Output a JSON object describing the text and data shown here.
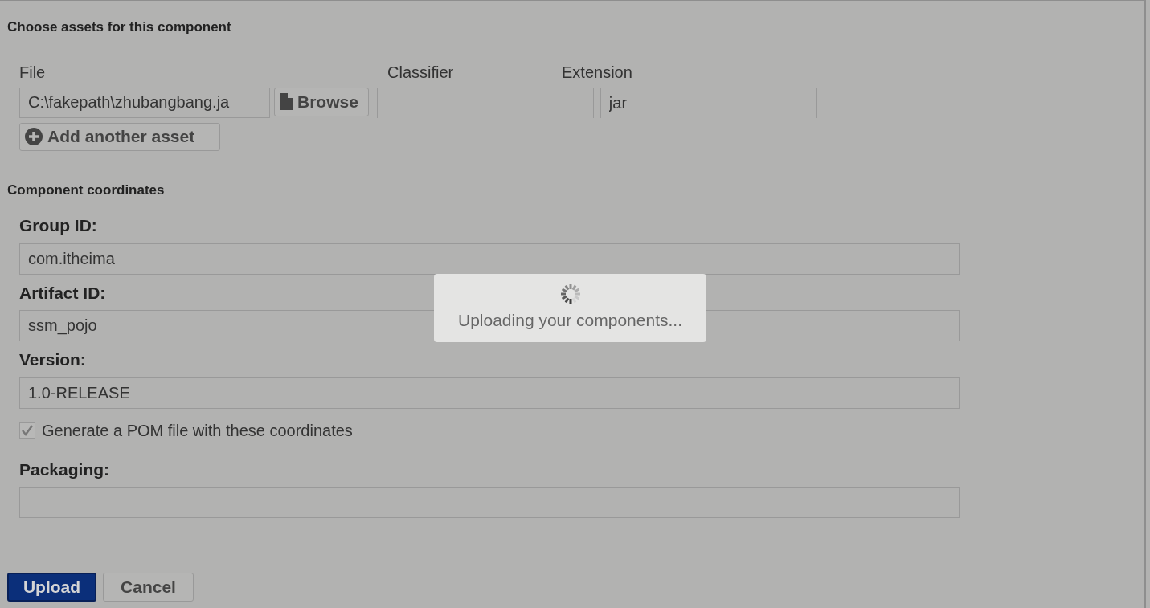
{
  "assets": {
    "heading": "Choose assets for this component",
    "columns": [
      "File",
      "Classifier",
      "Extension"
    ],
    "file": {
      "value": "C:\\fakepath\\zhubangbang.ja"
    },
    "browse_button": "Browse",
    "extension": {
      "value": "jar"
    },
    "add_button": "Add another asset"
  },
  "coordinates": {
    "heading": "Component coordinates",
    "fields": [
      {
        "label": "Group ID:",
        "value": "com.itheima"
      },
      {
        "label": "Artifact ID:",
        "value": "ssm_pojo"
      },
      {
        "label": "Version:",
        "value": "1.0-RELEASE"
      }
    ],
    "generate_pom": {
      "label": "Generate a POM file with these coordinates",
      "checked": true
    },
    "packaging": {
      "label": "Packaging:"
    }
  },
  "buttons": [
    {
      "label": "Upload",
      "kind": "primary"
    },
    {
      "label": "Cancel",
      "kind": "secondary"
    }
  ],
  "loading": {
    "message": "Uploading your components..."
  }
}
